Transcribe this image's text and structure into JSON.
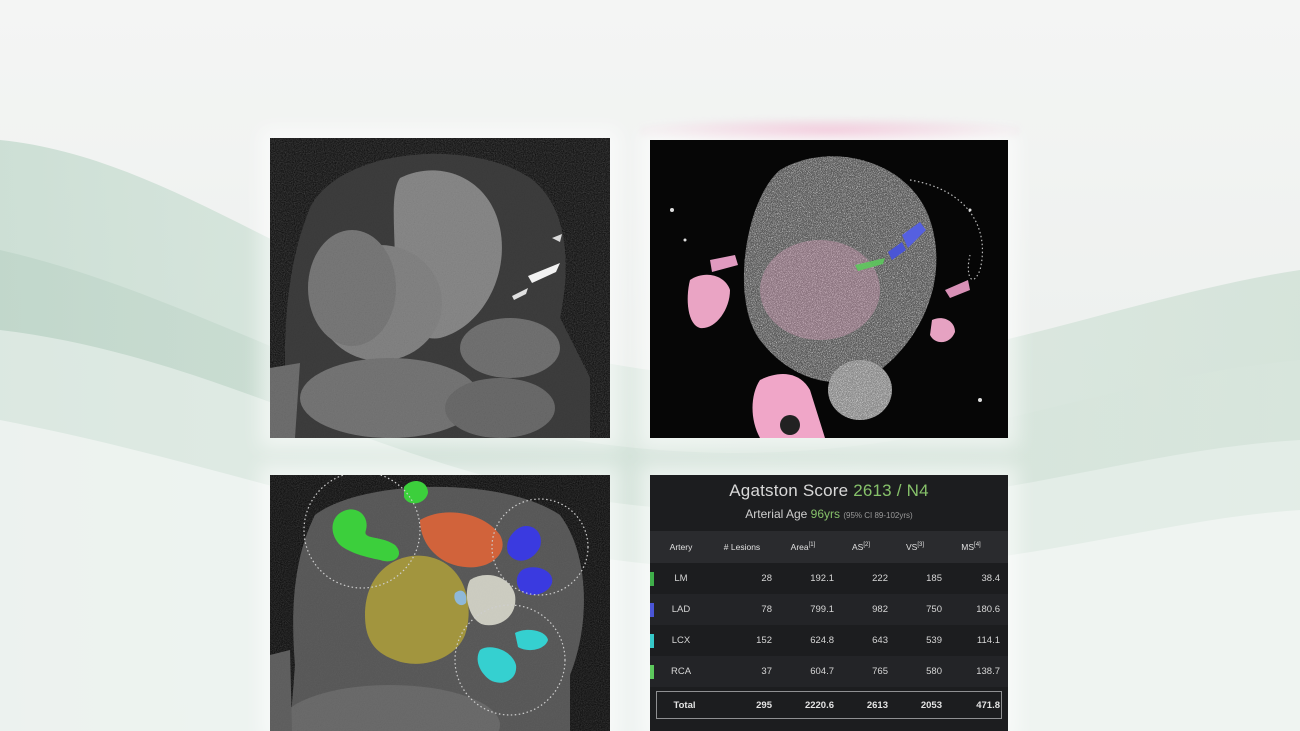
{
  "score_panel": {
    "title_prefix": "Agatston Score ",
    "title_value": "2613 / N4",
    "arterial_age_prefix": "Arterial Age ",
    "arterial_age_value": "96yrs",
    "arterial_age_ci": "(95% CI 89-102yrs)",
    "columns": [
      "Artery",
      "# Lesions",
      "Area",
      "AS",
      "VS",
      "MS"
    ],
    "column_refs": [
      "",
      "",
      "[1]",
      "[2]",
      "[3]",
      "[4]"
    ],
    "rows": [
      {
        "artery": "LM",
        "lesions": "28",
        "area": "192.1",
        "as": "222",
        "vs": "185",
        "ms": "38.4",
        "color": "#3fae4a"
      },
      {
        "artery": "LAD",
        "lesions": "78",
        "area": "799.1",
        "as": "982",
        "vs": "750",
        "ms": "180.6",
        "color": "#4a55d6"
      },
      {
        "artery": "LCX",
        "lesions": "152",
        "area": "624.8",
        "as": "643",
        "vs": "539",
        "ms": "114.1",
        "color": "#36c8c8"
      },
      {
        "artery": "RCA",
        "lesions": "37",
        "area": "604.7",
        "as": "765",
        "vs": "580",
        "ms": "138.7",
        "color": "#5cc85c"
      }
    ],
    "total": {
      "artery": "Total",
      "lesions": "295",
      "area": "2220.6",
      "as": "2613",
      "vs": "2053",
      "ms": "471.8"
    }
  },
  "colors": {
    "accent_green": "#86c16a",
    "segment_green": "#3ccf3c",
    "segment_orange": "#d8643a",
    "segment_olive": "#9a8a36",
    "segment_blue": "#3a3ae0",
    "segment_cyan": "#35d0d0",
    "pink_overlay": "#f0a0c8"
  }
}
